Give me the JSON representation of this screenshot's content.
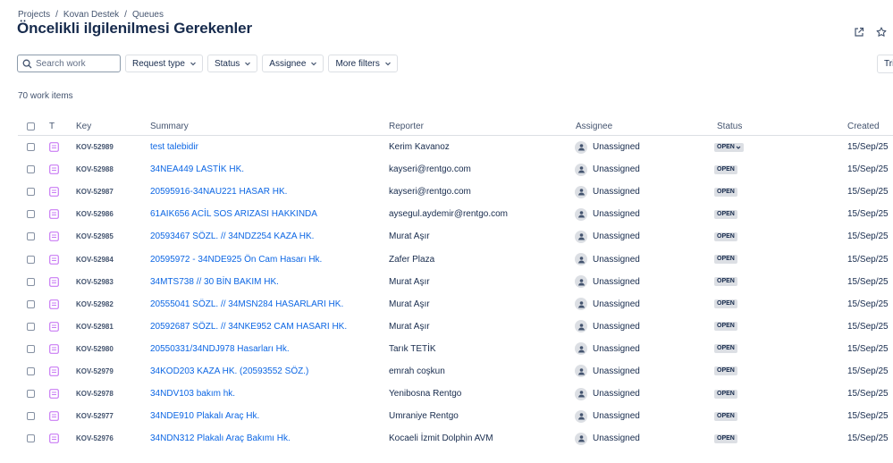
{
  "breadcrumb": {
    "items": [
      "Projects",
      "Kovan Destek",
      "Queues"
    ],
    "separator": "/"
  },
  "page": {
    "title": "Öncelikli ilgilenilmesi Gerekenler"
  },
  "actions": {
    "open_new_icon": "external-link-icon",
    "star_icon": "star-icon"
  },
  "toolbar": {
    "search_placeholder": "Search work",
    "filters": [
      "Request type",
      "Status",
      "Assignee",
      "More filters"
    ],
    "tri_label": "Tri"
  },
  "work_item_count": "70 work items",
  "table": {
    "columns": {
      "type": "T",
      "key": "Key",
      "summary": "Summary",
      "reporter": "Reporter",
      "assignee": "Assignee",
      "status": "Status",
      "created": "Created"
    },
    "rows": [
      {
        "key": "KOV-52989",
        "summary": "test talebidir",
        "reporter": "Kerim Kavanoz",
        "assignee": "Unassigned",
        "status": "OPEN",
        "created": "15/Sep/25"
      },
      {
        "key": "KOV-52988",
        "summary": "34NEA449 LASTİK HK.",
        "reporter": "kayseri@rentgo.com",
        "assignee": "Unassigned",
        "status": "OPEN",
        "created": "15/Sep/25"
      },
      {
        "key": "KOV-52987",
        "summary": "20595916-34NAU221 HASAR HK.",
        "reporter": "kayseri@rentgo.com",
        "assignee": "Unassigned",
        "status": "OPEN",
        "created": "15/Sep/25"
      },
      {
        "key": "KOV-52986",
        "summary": "61AIK656 ACİL SOS ARIZASI HAKKINDA",
        "reporter": "aysegul.aydemir@rentgo.com",
        "assignee": "Unassigned",
        "status": "OPEN",
        "created": "15/Sep/25"
      },
      {
        "key": "KOV-52985",
        "summary": "20593467 SÖZL. // 34NDZ254 KAZA HK.",
        "reporter": "Murat Aşır",
        "assignee": "Unassigned",
        "status": "OPEN",
        "created": "15/Sep/25"
      },
      {
        "key": "KOV-52984",
        "summary": "20595972 - 34NDE925 Ön Cam Hasarı Hk.",
        "reporter": "Zafer Plaza",
        "assignee": "Unassigned",
        "status": "OPEN",
        "created": "15/Sep/25"
      },
      {
        "key": "KOV-52983",
        "summary": "34MTS738 // 30 BİN BAKIM HK.",
        "reporter": "Murat Aşır",
        "assignee": "Unassigned",
        "status": "OPEN",
        "created": "15/Sep/25"
      },
      {
        "key": "KOV-52982",
        "summary": "20555041 SÖZL. // 34MSN284 HASARLARI HK.",
        "reporter": "Murat Aşır",
        "assignee": "Unassigned",
        "status": "OPEN",
        "created": "15/Sep/25"
      },
      {
        "key": "KOV-52981",
        "summary": "20592687 SÖZL. // 34NKE952 CAM HASARI HK.",
        "reporter": "Murat Aşır",
        "assignee": "Unassigned",
        "status": "OPEN",
        "created": "15/Sep/25"
      },
      {
        "key": "KOV-52980",
        "summary": "20550331/34NDJ978 Hasarları Hk.",
        "reporter": "Tarık TETİK",
        "assignee": "Unassigned",
        "status": "OPEN",
        "created": "15/Sep/25"
      },
      {
        "key": "KOV-52979",
        "summary": "34KOD203 KAZA HK. (20593552 SÖZ.)",
        "reporter": "emrah coşkun",
        "assignee": "Unassigned",
        "status": "OPEN",
        "created": "15/Sep/25"
      },
      {
        "key": "KOV-52978",
        "summary": "34NDV103 bakım hk.",
        "reporter": "Yenibosna Rentgo",
        "assignee": "Unassigned",
        "status": "OPEN",
        "created": "15/Sep/25"
      },
      {
        "key": "KOV-52977",
        "summary": "34NDE910 Plakalı Araç Hk.",
        "reporter": "Umraniye Rentgo",
        "assignee": "Unassigned",
        "status": "OPEN",
        "created": "15/Sep/25"
      },
      {
        "key": "KOV-52976",
        "summary": "34NDN312 Plakalı Araç Bakımı Hk.",
        "reporter": "Kocaeli İzmit Dolphin AVM",
        "assignee": "Unassigned",
        "status": "OPEN",
        "created": "15/Sep/25"
      }
    ]
  },
  "colors": {
    "link": "#0c66e4",
    "text": "#172b4d",
    "muted": "#44546f",
    "status_bg": "#dcdfe4",
    "type_icon": "#c97cf4"
  }
}
